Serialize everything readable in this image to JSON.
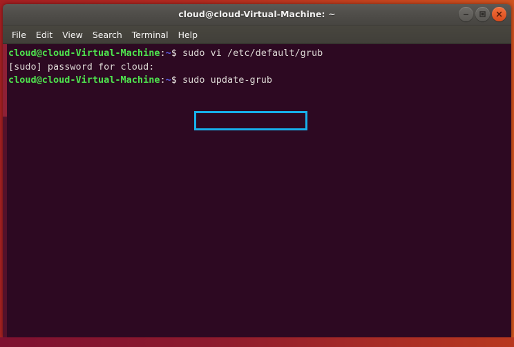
{
  "window": {
    "title": "cloud@cloud-Virtual-Machine: ~",
    "buttons": {
      "minimize": "minimize",
      "maximize": "maximize",
      "close": "close"
    }
  },
  "menubar": {
    "items": [
      {
        "label": "File"
      },
      {
        "label": "Edit"
      },
      {
        "label": "View"
      },
      {
        "label": "Search"
      },
      {
        "label": "Terminal"
      },
      {
        "label": "Help"
      }
    ]
  },
  "terminal": {
    "lines": [
      {
        "prompt_user_host": "cloud@cloud-Virtual-Machine",
        "prompt_colon": ":",
        "prompt_path": "~",
        "prompt_sigil": "$",
        "command": " sudo vi /etc/default/grub"
      },
      {
        "text": "[sudo] password for cloud:"
      },
      {
        "prompt_user_host": "cloud@cloud-Virtual-Machine",
        "prompt_colon": ":",
        "prompt_path": "~",
        "prompt_sigil": "$",
        "command": " sudo update-grub"
      }
    ]
  },
  "highlight": {
    "label": "sudo update-grub",
    "color": "#17b0ea"
  },
  "colors": {
    "terminal_background": "#2d0922",
    "prompt_green": "#4ee44e",
    "prompt_blue": "#5c5ce6",
    "text_white": "#e6e1de",
    "titlebar": "#504e4a",
    "close_button": "#da4a1c",
    "desktop_left": "#a51f22",
    "desktop_right": "#d4581f"
  }
}
